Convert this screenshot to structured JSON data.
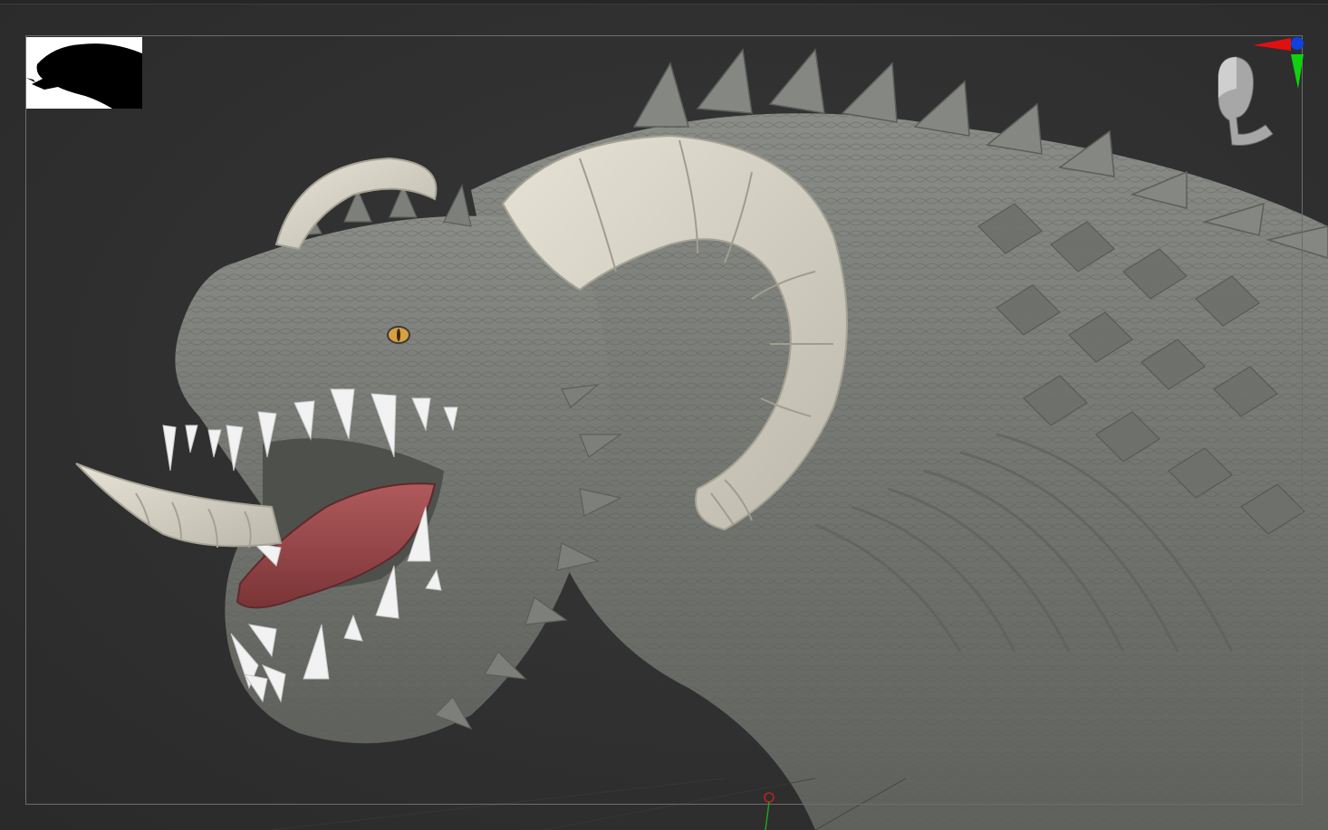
{
  "viewport": {
    "background_color": "#2f2f2f",
    "frame_color": "#6d6d6d"
  },
  "thumbnail": {
    "icon": "creature-silhouette-icon",
    "background": "#ffffff",
    "silhouette_color": "#000000"
  },
  "navigation_gizmo": {
    "icon": "head-orientation-icon",
    "axis_colors": {
      "x": "#e01010",
      "y": "#10d010",
      "z": "#1040e0"
    }
  },
  "model": {
    "name_icon": "sculpt-creature-model",
    "skin_color": "#7b7d79",
    "horn_color": "#d8d5c8",
    "tongue_color": "#9a4a4c",
    "teeth_color": "#f2f2f2",
    "eye_color": "#d8a040"
  },
  "floor": {
    "marker_color": "#c02020",
    "axis_color": "#20a020"
  }
}
